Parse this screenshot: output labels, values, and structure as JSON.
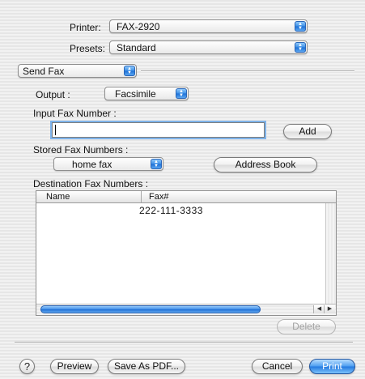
{
  "printer": {
    "label": "Printer:",
    "value": "FAX-2920"
  },
  "presets": {
    "label": "Presets:",
    "value": "Standard"
  },
  "pane": {
    "value": "Send Fax"
  },
  "output": {
    "label": "Output :",
    "value": "Facsimile"
  },
  "input_fax": {
    "label": "Input Fax Number :",
    "value": "",
    "add_label": "Add"
  },
  "stored": {
    "label": "Stored Fax Numbers :",
    "value": "home fax",
    "address_book_label": "Address Book"
  },
  "destination": {
    "label": "Destination Fax Numbers :",
    "columns": [
      "Name",
      "Fax#"
    ],
    "rows": [
      {
        "name": "",
        "fax": "222-111-3333"
      }
    ],
    "delete_label": "Delete"
  },
  "footer": {
    "help": "?",
    "preview_label": "Preview",
    "save_pdf_label": "Save As PDF...",
    "cancel_label": "Cancel",
    "print_label": "Print"
  },
  "colors": {
    "accent": "#2479e0",
    "focus_ring": "#7fb3ea"
  },
  "icons": {
    "popup_arrows": "updown-arrow-icon",
    "help": "question-icon"
  }
}
